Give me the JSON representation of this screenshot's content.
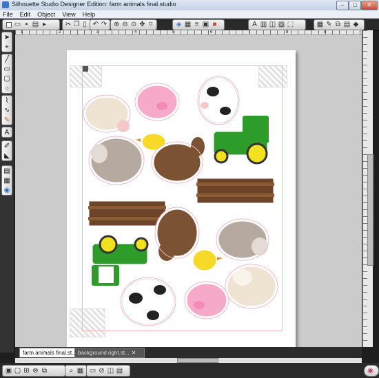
{
  "window": {
    "title": "Silhouette Studio Designer Edition: farm animals final.studio",
    "minimize": "–",
    "maximize": "□",
    "close": "✕"
  },
  "menu": [
    "File",
    "Edit",
    "Object",
    "View",
    "Help"
  ],
  "rulers": {
    "h_labels": [
      "1",
      "2",
      "3",
      "4",
      "5",
      "6",
      "7",
      "8",
      "9"
    ]
  },
  "tabs": [
    {
      "label": "farm animals final.st...",
      "active": true
    },
    {
      "label": "background right.st...",
      "active": false
    }
  ],
  "tab_close": "✕",
  "colors": {
    "cut_line": "#f3b7b7",
    "tractor_green": "#2e9c2a",
    "tractor_yellow": "#f2e21d",
    "fence_brown": "#6e4428",
    "horse_brown": "#7b5232",
    "pig_pink": "#f6a9c9",
    "chick_yellow": "#f7d928",
    "sheep_cream": "#efe4d2",
    "goat_gray": "#b5a9a0"
  },
  "icons": {
    "toolbar": [
      "new-icon",
      "open-icon",
      "save-icon",
      "print-icon",
      "send-to-silhouette-icon",
      "cut-icon",
      "copy-icon",
      "paste-icon",
      "undo-icon",
      "redo-icon",
      "zoom-in-icon",
      "zoom-out-icon",
      "zoom-select-icon",
      "pan-icon",
      "fit-page-icon",
      "fill-color-icon",
      "line-color-icon",
      "line-style-icon",
      "text-style-icon",
      "replicate-icon",
      "offset-icon",
      "trace-icon",
      "cut-settings-icon",
      "design-store-icon"
    ],
    "sidebar": [
      "select-icon",
      "edit-points-icon",
      "line-icon",
      "rectangle-icon",
      "rounded-rect-icon",
      "ellipse-icon",
      "polygon-icon",
      "curve-icon",
      "freehand-icon",
      "text-icon",
      "eraser-icon",
      "knife-icon",
      "library-icon",
      "store-icon"
    ]
  }
}
